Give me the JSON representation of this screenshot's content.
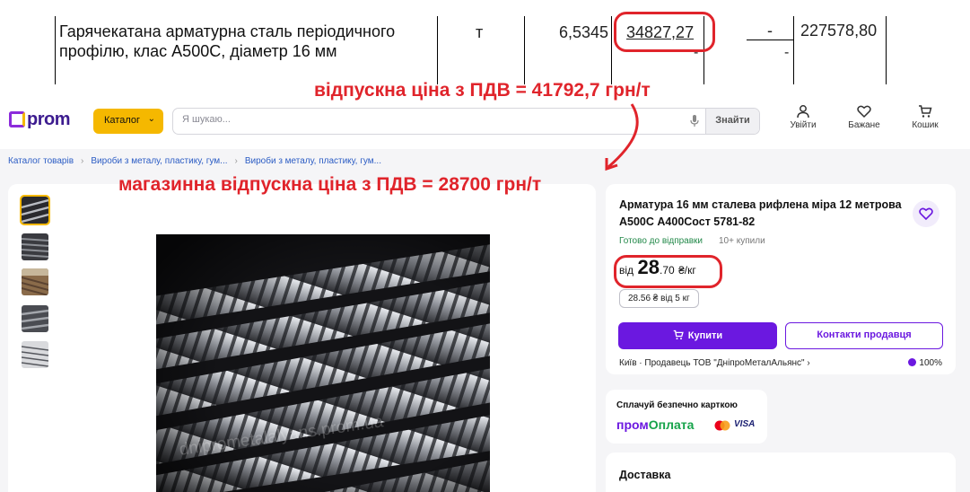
{
  "sheet": {
    "description": "Гарячекатана арматурна сталь періодичного профілю, клас А500С, діаметр 16 мм",
    "unit": "т",
    "quantity": "6,5345",
    "price": "34827,27",
    "dash": "-",
    "total": "227578,80"
  },
  "annotations": {
    "vat_price": "відпускна ціна з ПДВ = 41792,7 грн/т",
    "store_price": "магазинна відпускна ціна з ПДВ = 28700 грн/т",
    "color": "#e0242b"
  },
  "header": {
    "logo": "prom",
    "catalog_label": "Каталог",
    "search_placeholder": "Я шукаю...",
    "find_label": "Знайти",
    "login_label": "Увійти",
    "favorites_label": "Бажане",
    "cart_label": "Кошик"
  },
  "breadcrumbs": [
    "Каталог товарів",
    "Вироби з металу, пластику, гум...",
    "Вироби з металу, пластику, гум..."
  ],
  "gallery": {
    "watermark": "dniprometalalyans.prom.ua"
  },
  "product": {
    "title": "Арматура 16 мм сталева рифлена міра 12 метрова А500С А400Сост 5781-82",
    "status": "Готово до відправки",
    "bought": "10+ купили",
    "price_from": "від",
    "price_int": "28",
    "price_cents": ".70",
    "price_unit": "₴/кг",
    "wholesale": "28.56 ₴ від 5 кг",
    "buy_label": "Купити",
    "contact_label": "Контакти продавця",
    "seller": "Київ · Продавець ТОВ \"ДніпроМеталАльянс\"",
    "rating": "100%"
  },
  "payment": {
    "title": "Сплачуй безпечно карткою",
    "brand_a": "пром",
    "brand_b": "Оплата",
    "visa": "VISA"
  },
  "delivery": {
    "title": "Доставка"
  },
  "colors": {
    "accent": "#6b18e0",
    "catalog": "#f5b800",
    "status": "#23894a"
  }
}
